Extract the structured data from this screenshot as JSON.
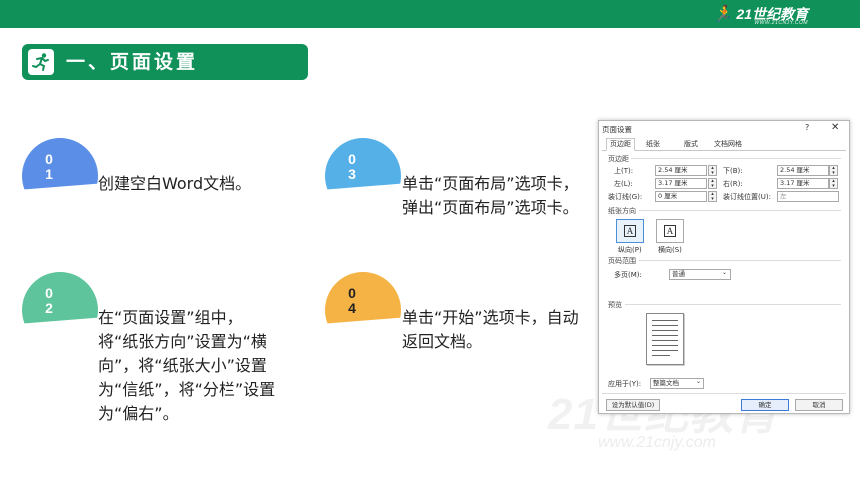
{
  "colors": {
    "brand_green": "#10915a",
    "badge1": "#5b8ee6",
    "badge2": "#56b0e8",
    "badge3": "#5ec49b",
    "badge4": "#f5b345"
  },
  "header": {
    "logo_text": "21世纪教育",
    "logo_sub": "WWW.21CNJY.COM",
    "logo_icon": "runner-icon"
  },
  "section_title": {
    "text": "一、页面设置",
    "icon": "runner-icon"
  },
  "steps": [
    {
      "digits": [
        "0",
        "1"
      ],
      "text": "创建空白Word文档。"
    },
    {
      "digits": [
        "0",
        "3"
      ],
      "text": "单击“页面布局”选项卡，弹出“页面布局”选项卡。"
    },
    {
      "digits": [
        "0",
        "2"
      ],
      "text": "在“页面设置”组中，将“纸张方向”设置为“横向”，将“纸张大小”设置为“信纸”，将“分栏”设置为“偏右”。"
    },
    {
      "digits": [
        "0",
        "4"
      ],
      "text": "单击“开始”选项卡，自动返回文档。"
    }
  ],
  "dialog": {
    "title": "页面设置",
    "help": "?",
    "close": "✕",
    "tabs": [
      "页边距",
      "纸张",
      "版式",
      "文档网格"
    ],
    "margins_label": "页边距",
    "top_label": "上(T):",
    "top_value": "2.54 厘米",
    "bottom_label": "下(B):",
    "bottom_value": "2.54 厘米",
    "left_label": "左(L):",
    "left_value": "3.17 厘米",
    "right_label": "右(R):",
    "right_value": "3.17 厘米",
    "gutter_label": "装订线(G):",
    "gutter_value": "0 厘米",
    "gutter_pos_label": "装订线位置(U):",
    "gutter_pos_value": "左",
    "orientation_label": "纸张方向",
    "portrait_label": "纵向(P)",
    "landscape_label": "横向(S)",
    "pages_label": "页码范围",
    "multi_label": "多页(M):",
    "multi_value": "普通",
    "preview_label": "预览",
    "apply_label": "应用于(Y):",
    "apply_value": "整篇文档",
    "default_btn": "设为默认值(D)",
    "ok_btn": "确定",
    "cancel_btn": "取消"
  },
  "watermark": {
    "text": "21世纪教育",
    "sub": "www.21cnjy.com"
  }
}
